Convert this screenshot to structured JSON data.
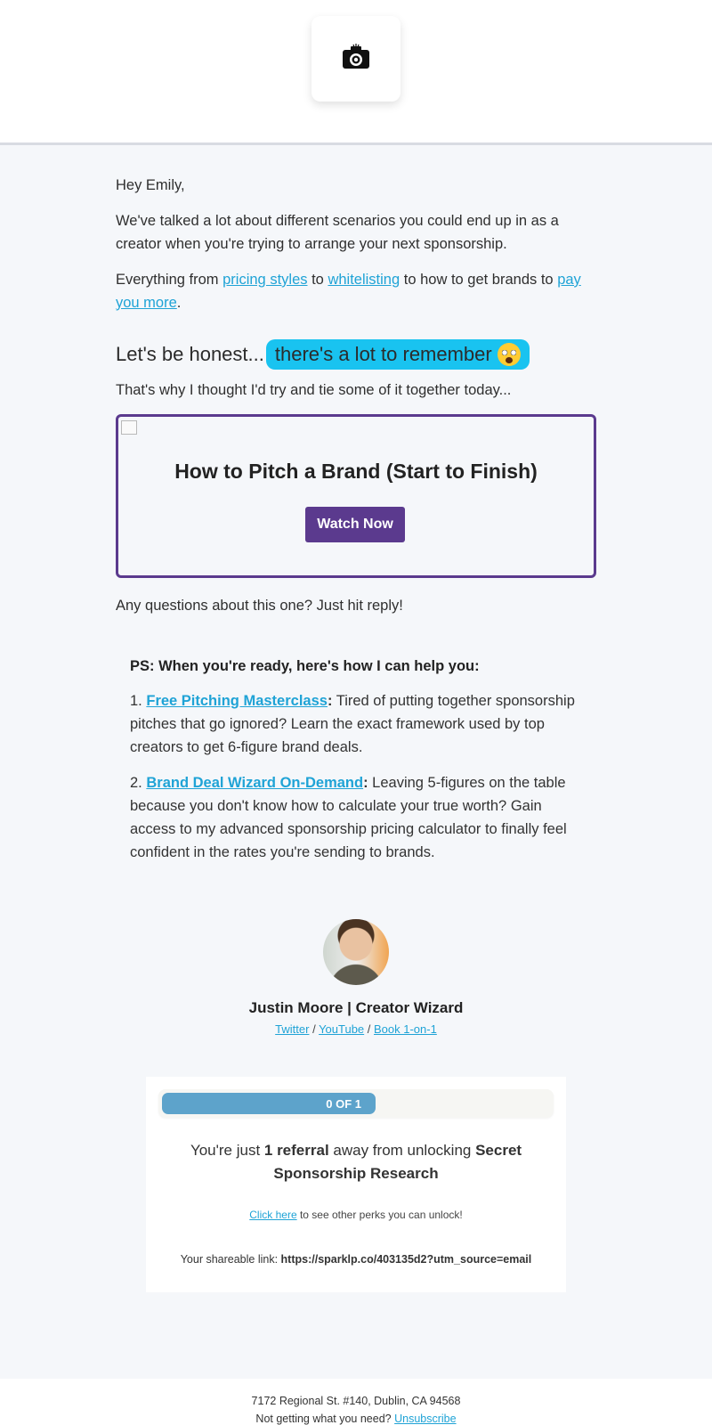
{
  "header": {
    "logo_icon": "camera-icon"
  },
  "intro": {
    "greeting": "Hey Emily,",
    "p1": "We've talked a lot about different scenarios you could end up in as a creator when you're trying to arrange your next sponsorship.",
    "p2_prefix": "Everything from ",
    "link_pricing": "pricing styles",
    "p2_to": " to ",
    "link_whitelisting": "whitelisting",
    "p2_mid": " to how to get brands to ",
    "link_pay": "pay you more",
    "p2_end": "."
  },
  "honest": {
    "lead": "Let's be honest...",
    "highlight": "there's a lot to remember",
    "emoji": "exploding-head-icon"
  },
  "tie": "That's why I thought I'd try and tie some of it together today...",
  "video": {
    "title": "How to Pitch a Brand (Start to Finish)",
    "button": "Watch Now"
  },
  "questions": "Any questions about this one? Just hit reply!",
  "ps": {
    "title": "PS: When you're ready, here's how I can help you:",
    "items": [
      {
        "num": "1. ",
        "link": "Free Pitching Masterclass",
        "colon": ":",
        "text": " Tired of putting together sponsorship pitches that go ignored? Learn the exact framework used by top creators to get 6-figure brand deals."
      },
      {
        "num": "2. ",
        "link": "Brand Deal Wizard On-Demand",
        "colon": ":",
        "text": " Leaving 5-figures on the table because you don't know how to calculate your true worth? Gain access to my advanced sponsorship pricing calculator to finally feel confident in the rates you're sending to brands."
      }
    ]
  },
  "signature": {
    "name": "Justin Moore | Creator Wizard",
    "link_twitter": "Twitter",
    "sep1": " / ",
    "link_youtube": "YouTube",
    "sep2": " / ",
    "link_book": "Book 1-on-1"
  },
  "referral": {
    "progress_label": "0 OF 1",
    "progress_fraction": 0.55,
    "text_prefix": "You're just ",
    "text_bold1": "1 referral",
    "text_mid": " away from unlocking ",
    "text_bold2": "Secret Sponsorship Research",
    "perks_link": "Click here",
    "perks_text": " to see other perks you can unlock!",
    "share_label": "Your shareable link: ",
    "share_url": "https://sparklp.co/403135d2?utm_source=email"
  },
  "footer": {
    "address": "7172 Regional St. #140, Dublin, CA 94568",
    "unsub_prefix": "Not getting what you need? ",
    "unsub_link": "Unsubscribe"
  },
  "colors": {
    "accent_purple": "#5b3a8e",
    "link_blue": "#1fa3d6",
    "highlight_cyan": "#19c3f0",
    "progress_blue": "#5da3cb"
  }
}
